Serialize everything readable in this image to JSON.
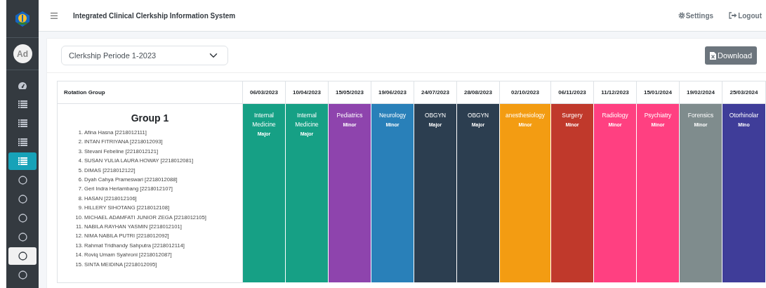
{
  "sidebar": {
    "items": [
      {
        "kind": "dashboard",
        "selected": false,
        "hovered": false
      },
      {
        "kind": "list",
        "selected": false,
        "hovered": false
      },
      {
        "kind": "list",
        "selected": false,
        "hovered": false
      },
      {
        "kind": "list",
        "selected": false,
        "hovered": false
      },
      {
        "kind": "list",
        "selected": true,
        "hovered": false
      },
      {
        "kind": "circle",
        "selected": false,
        "hovered": false
      },
      {
        "kind": "circle",
        "selected": false,
        "hovered": false
      },
      {
        "kind": "circle",
        "selected": false,
        "hovered": false
      },
      {
        "kind": "circle",
        "selected": false,
        "hovered": false
      },
      {
        "kind": "circle",
        "selected": false,
        "hovered": true
      },
      {
        "kind": "circle",
        "selected": false,
        "hovered": false
      }
    ],
    "avatar": "Ad"
  },
  "topbar": {
    "title": "Integrated Clinical Clerkship Information System",
    "links": [
      {
        "kind": "settings",
        "label": "Settings"
      },
      {
        "kind": "logout",
        "label": "Logout"
      }
    ]
  },
  "period_select": {
    "value": "Clerkship Periode 1-2023"
  },
  "download_button": "Download",
  "table": {
    "first_column": "Rotation Group",
    "dates": [
      "06/03/2023",
      "10/04/2023",
      "15/05/2023",
      "19/06/2023",
      "24/07/2023",
      "28/08/2023",
      "02/10/2023",
      "06/11/2023",
      "11/12/2023",
      "15/01/2024",
      "19/02/2024",
      "25/03/2024"
    ],
    "rows": [
      {
        "group": "Group 1",
        "members": [
          {
            "number": "1.",
            "name": "Afina Hasna [2218012111]"
          },
          {
            "number": "2.",
            "name": "INTAN FITRIYANA [2218012093]"
          },
          {
            "number": "3.",
            "name": "Stevani Febeline [2218012121]"
          },
          {
            "number": "4.",
            "name": "SUSAN YULIA LAURA HOWAY [2218012081]"
          },
          {
            "number": "5.",
            "name": "DIMAS [2218012122]"
          },
          {
            "number": "6.",
            "name": "Dyah Cahya Prameswari [2218012088]"
          },
          {
            "number": "7.",
            "name": "Geri Indra Herlambang [2218012107]"
          },
          {
            "number": "8.",
            "name": "HASAN [2218012106]"
          },
          {
            "number": "9.",
            "name": "HILLERY SIHOTANG [2218012108]"
          },
          {
            "number": "10.",
            "name": "MICHAEL ADAMFATI JUNIOR ZEGA [2218012105]"
          },
          {
            "number": "11.",
            "name": "NABILA RAYHAN YASMIN [2218012101]"
          },
          {
            "number": "12.",
            "name": "NIMA NABILA PUTRI [2218012092]"
          },
          {
            "number": "13.",
            "name": "Rahmat Tridhandy Sahputra [2218012114]"
          },
          {
            "number": "14.",
            "name": "Roviq Umam Syahroni [2218012087]"
          },
          {
            "number": "15.",
            "name": "SINTA MEIDINA [2218012095]"
          }
        ],
        "rotations": [
          {
            "name": "Internal Medicine",
            "type": "Major",
            "color": "#16a085"
          },
          {
            "name": "Internal Medicine",
            "type": "Major",
            "color": "#16a085"
          },
          {
            "name": "Pediatrics",
            "type": "Minor",
            "color": "#8e44ad"
          },
          {
            "name": "Neurology",
            "type": "Minor",
            "color": "#2980b9"
          },
          {
            "name": "OBGYN",
            "type": "Major",
            "color": "#2c3e50"
          },
          {
            "name": "OBGYN",
            "type": "Major",
            "color": "#2c3e50"
          },
          {
            "name": "anesthesiology",
            "type": "Minor",
            "color": "#f39c12"
          },
          {
            "name": "Surgery",
            "type": "Minor",
            "color": "#c0392b"
          },
          {
            "name": "Radiology",
            "type": "Minor",
            "color": "#ff4081"
          },
          {
            "name": "Psychiatry",
            "type": "Minor",
            "color": "#ff4081"
          },
          {
            "name": "Forensics",
            "type": "Minor",
            "color": "#7f8c8d"
          },
          {
            "name": "Otorhinolar",
            "type": "Mino",
            "color": "#3f3d99"
          }
        ]
      }
    ]
  }
}
